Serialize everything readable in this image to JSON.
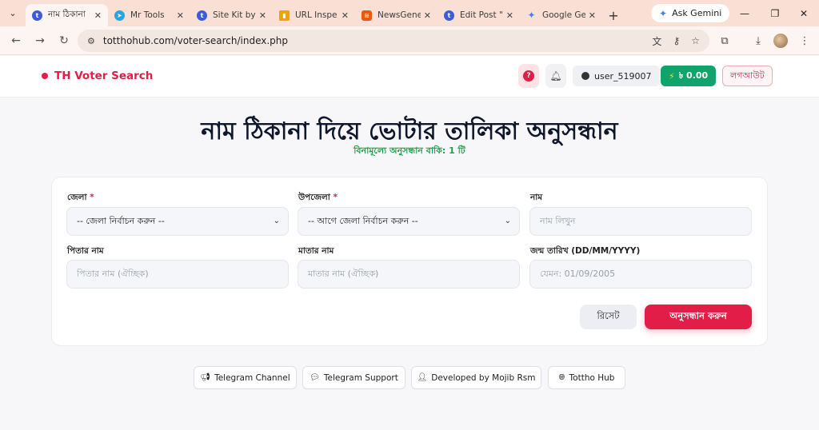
{
  "browser": {
    "tabs": [
      {
        "title": "নাম ঠিকানা",
        "icon": "tottho-icon",
        "color": "#3b5bdb"
      },
      {
        "title": "Mr Tools",
        "icon": "telegram-icon",
        "color": "#2aa3df"
      },
      {
        "title": "Site Kit by",
        "icon": "tottho-icon",
        "color": "#3b5bdb"
      },
      {
        "title": "URL Inspe",
        "icon": "analytics-icon",
        "color": "#f59f00"
      },
      {
        "title": "NewsGene",
        "icon": "newsgen-icon",
        "color": "#e8590c"
      },
      {
        "title": "Edit Post \"",
        "icon": "tottho-icon",
        "color": "#3b5bdb"
      },
      {
        "title": "Google Ge",
        "icon": "gemini-icon",
        "color": "#4a7ff0"
      }
    ],
    "ask_gemini": "Ask Gemini",
    "url": "totthohub.com/voter-search/index.php"
  },
  "header": {
    "brand": "TH Voter Search",
    "help": "?",
    "username": "user_519007",
    "balance": "৳ 0.00",
    "logout": "লগআউট"
  },
  "main": {
    "title": "নাম ঠিকানা দিয়ে ভোটার তালিকা অনুসন্ধান",
    "subtitle": "বিনামূল্যে অনুসন্ধান বাকি: 1 টি"
  },
  "form": {
    "district": {
      "label": "জেলা",
      "required": "*",
      "value": "-- জেলা নির্বাচন করুন --"
    },
    "upazila": {
      "label": "উপজেলা",
      "required": "*",
      "value": "-- আগে জেলা নির্বাচন করুন --"
    },
    "name": {
      "label": "নাম",
      "placeholder": "নাম লিখুন"
    },
    "father": {
      "label": "পিতার নাম",
      "placeholder": "পিতার নাম (ঐচ্ছিক)"
    },
    "mother": {
      "label": "মাতার নাম",
      "placeholder": "মাতার নাম (ঐচ্ছিক)"
    },
    "dob": {
      "label": "জন্ম তারিখ (DD/MM/YYYY)",
      "placeholder": "যেমন: 01/09/2005"
    },
    "reset_label": "রিসেট",
    "search_label": "অনুসন্ধান করুন"
  },
  "footer": {
    "links": [
      {
        "label": "Telegram Channel",
        "icon": "megaphone-icon"
      },
      {
        "label": "Telegram Support",
        "icon": "chat-icon"
      },
      {
        "label": "Developed by Mojib Rsm",
        "icon": "person-icon"
      },
      {
        "label": "Tottho Hub",
        "icon": "globe-icon"
      }
    ]
  },
  "colors": {
    "accent": "#e11d48",
    "success": "#16a34a",
    "balance_bg": "#10a36b"
  }
}
